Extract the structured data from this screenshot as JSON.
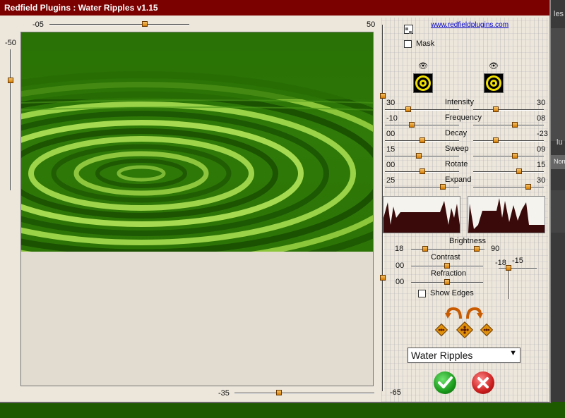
{
  "background_app": {
    "top_text": "les",
    "panel_text": "Norm",
    "sidebar_text": "lu"
  },
  "dialog": {
    "title": "Redfield Plugins : Water Ripples v1.15",
    "link": "www.redfieldplugins.com",
    "mask_label": "Mask",
    "top_slider": {
      "min_label": "-05",
      "max_label": "50",
      "level": 0.68
    },
    "left_slider": {
      "label": "-50",
      "level": 0.78
    },
    "bottom_slider": {
      "label": "-35",
      "level": 0.32
    },
    "right_slider": {
      "label": "-65"
    },
    "params": [
      {
        "name": "Intensity",
        "left": "30",
        "right": "30"
      },
      {
        "name": "Frequency",
        "left": "-10",
        "right": "08"
      },
      {
        "name": "Decay",
        "left": "00",
        "right": "-23"
      },
      {
        "name": "Sweep",
        "left": "15",
        "right": "09"
      },
      {
        "name": "Rotate",
        "left": "00",
        "right": "15"
      },
      {
        "name": "Expand",
        "left": "25",
        "right": "30"
      }
    ],
    "brightness": {
      "label": "Brightness",
      "left": "18",
      "right": "90"
    },
    "contrast": {
      "label": "Contrast",
      "value": "00"
    },
    "refraction": {
      "label": "Refraction",
      "value": "00"
    },
    "light_readout": {
      "x": "-18",
      "y": "-15"
    },
    "show_edges_label": "Show Edges",
    "preset": {
      "selected": "Water Ripples"
    },
    "colors": {
      "title_bar": "#7b0000",
      "accent": "#e0900a",
      "water_green": "#2b7a06",
      "ok": "#1a9a1a",
      "cancel": "#cc1e1e"
    },
    "icons": [
      "view-toggle-icon",
      "eye-icon",
      "ripple-light-icon",
      "undo-icon",
      "redo-icon",
      "dice-icon",
      "ok-check-icon",
      "cancel-x-icon",
      "dropdown-arrow-icon"
    ]
  }
}
